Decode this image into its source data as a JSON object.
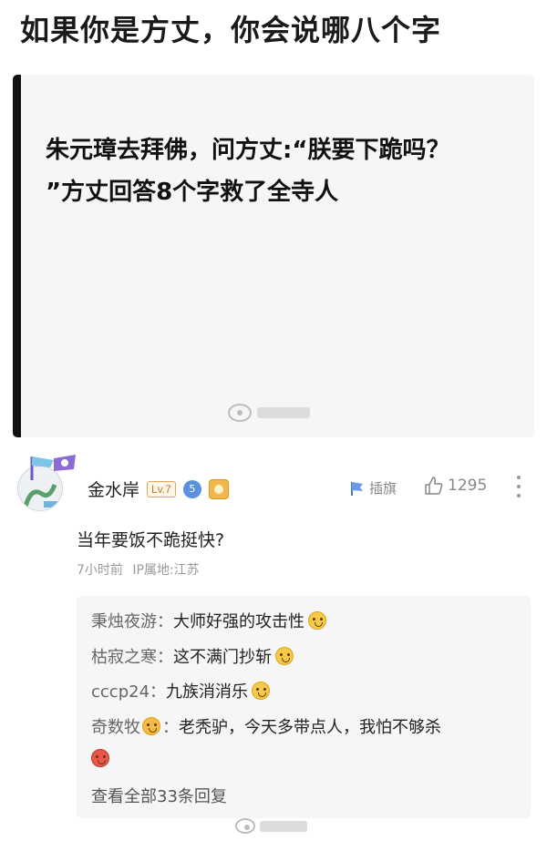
{
  "page": {
    "title": "如果你是方丈，你会说哪八个字"
  },
  "post": {
    "headline_line1": "朱元璋去拜佛，问方丈:“朕要下跪吗？",
    "headline_line2": "”方丈回答8个字救了全寺人"
  },
  "comment": {
    "username": "金水岸",
    "level": "Lv.7",
    "fan_badge": "5",
    "flag_label": "插旗",
    "like_count": "1295",
    "text": "当年要饭不跪挺快?",
    "time": "7小时前",
    "location": "IP属地:江苏"
  },
  "replies": [
    {
      "author": "秉烛夜游：",
      "body": "大师好强的攻击性",
      "emoji": "grin-emoji"
    },
    {
      "author": "枯寂之寒：",
      "body": "这不满门抄斩",
      "emoji": "grin-emoji"
    },
    {
      "author": "cccp24：",
      "body": "九族消消乐",
      "emoji": "grin-emoji"
    },
    {
      "author": "奇数牧",
      "author_suffix": "：",
      "body": "老秃驴，今天多带点人，我怕不够杀",
      "emoji": "angry-emoji"
    }
  ],
  "view_all": "查看全部33条回复",
  "colors": {
    "accent_border": "#111111",
    "reply_bg": "#f6f6f6",
    "meta_text": "#999999",
    "level_badge": "#e3a55a"
  }
}
